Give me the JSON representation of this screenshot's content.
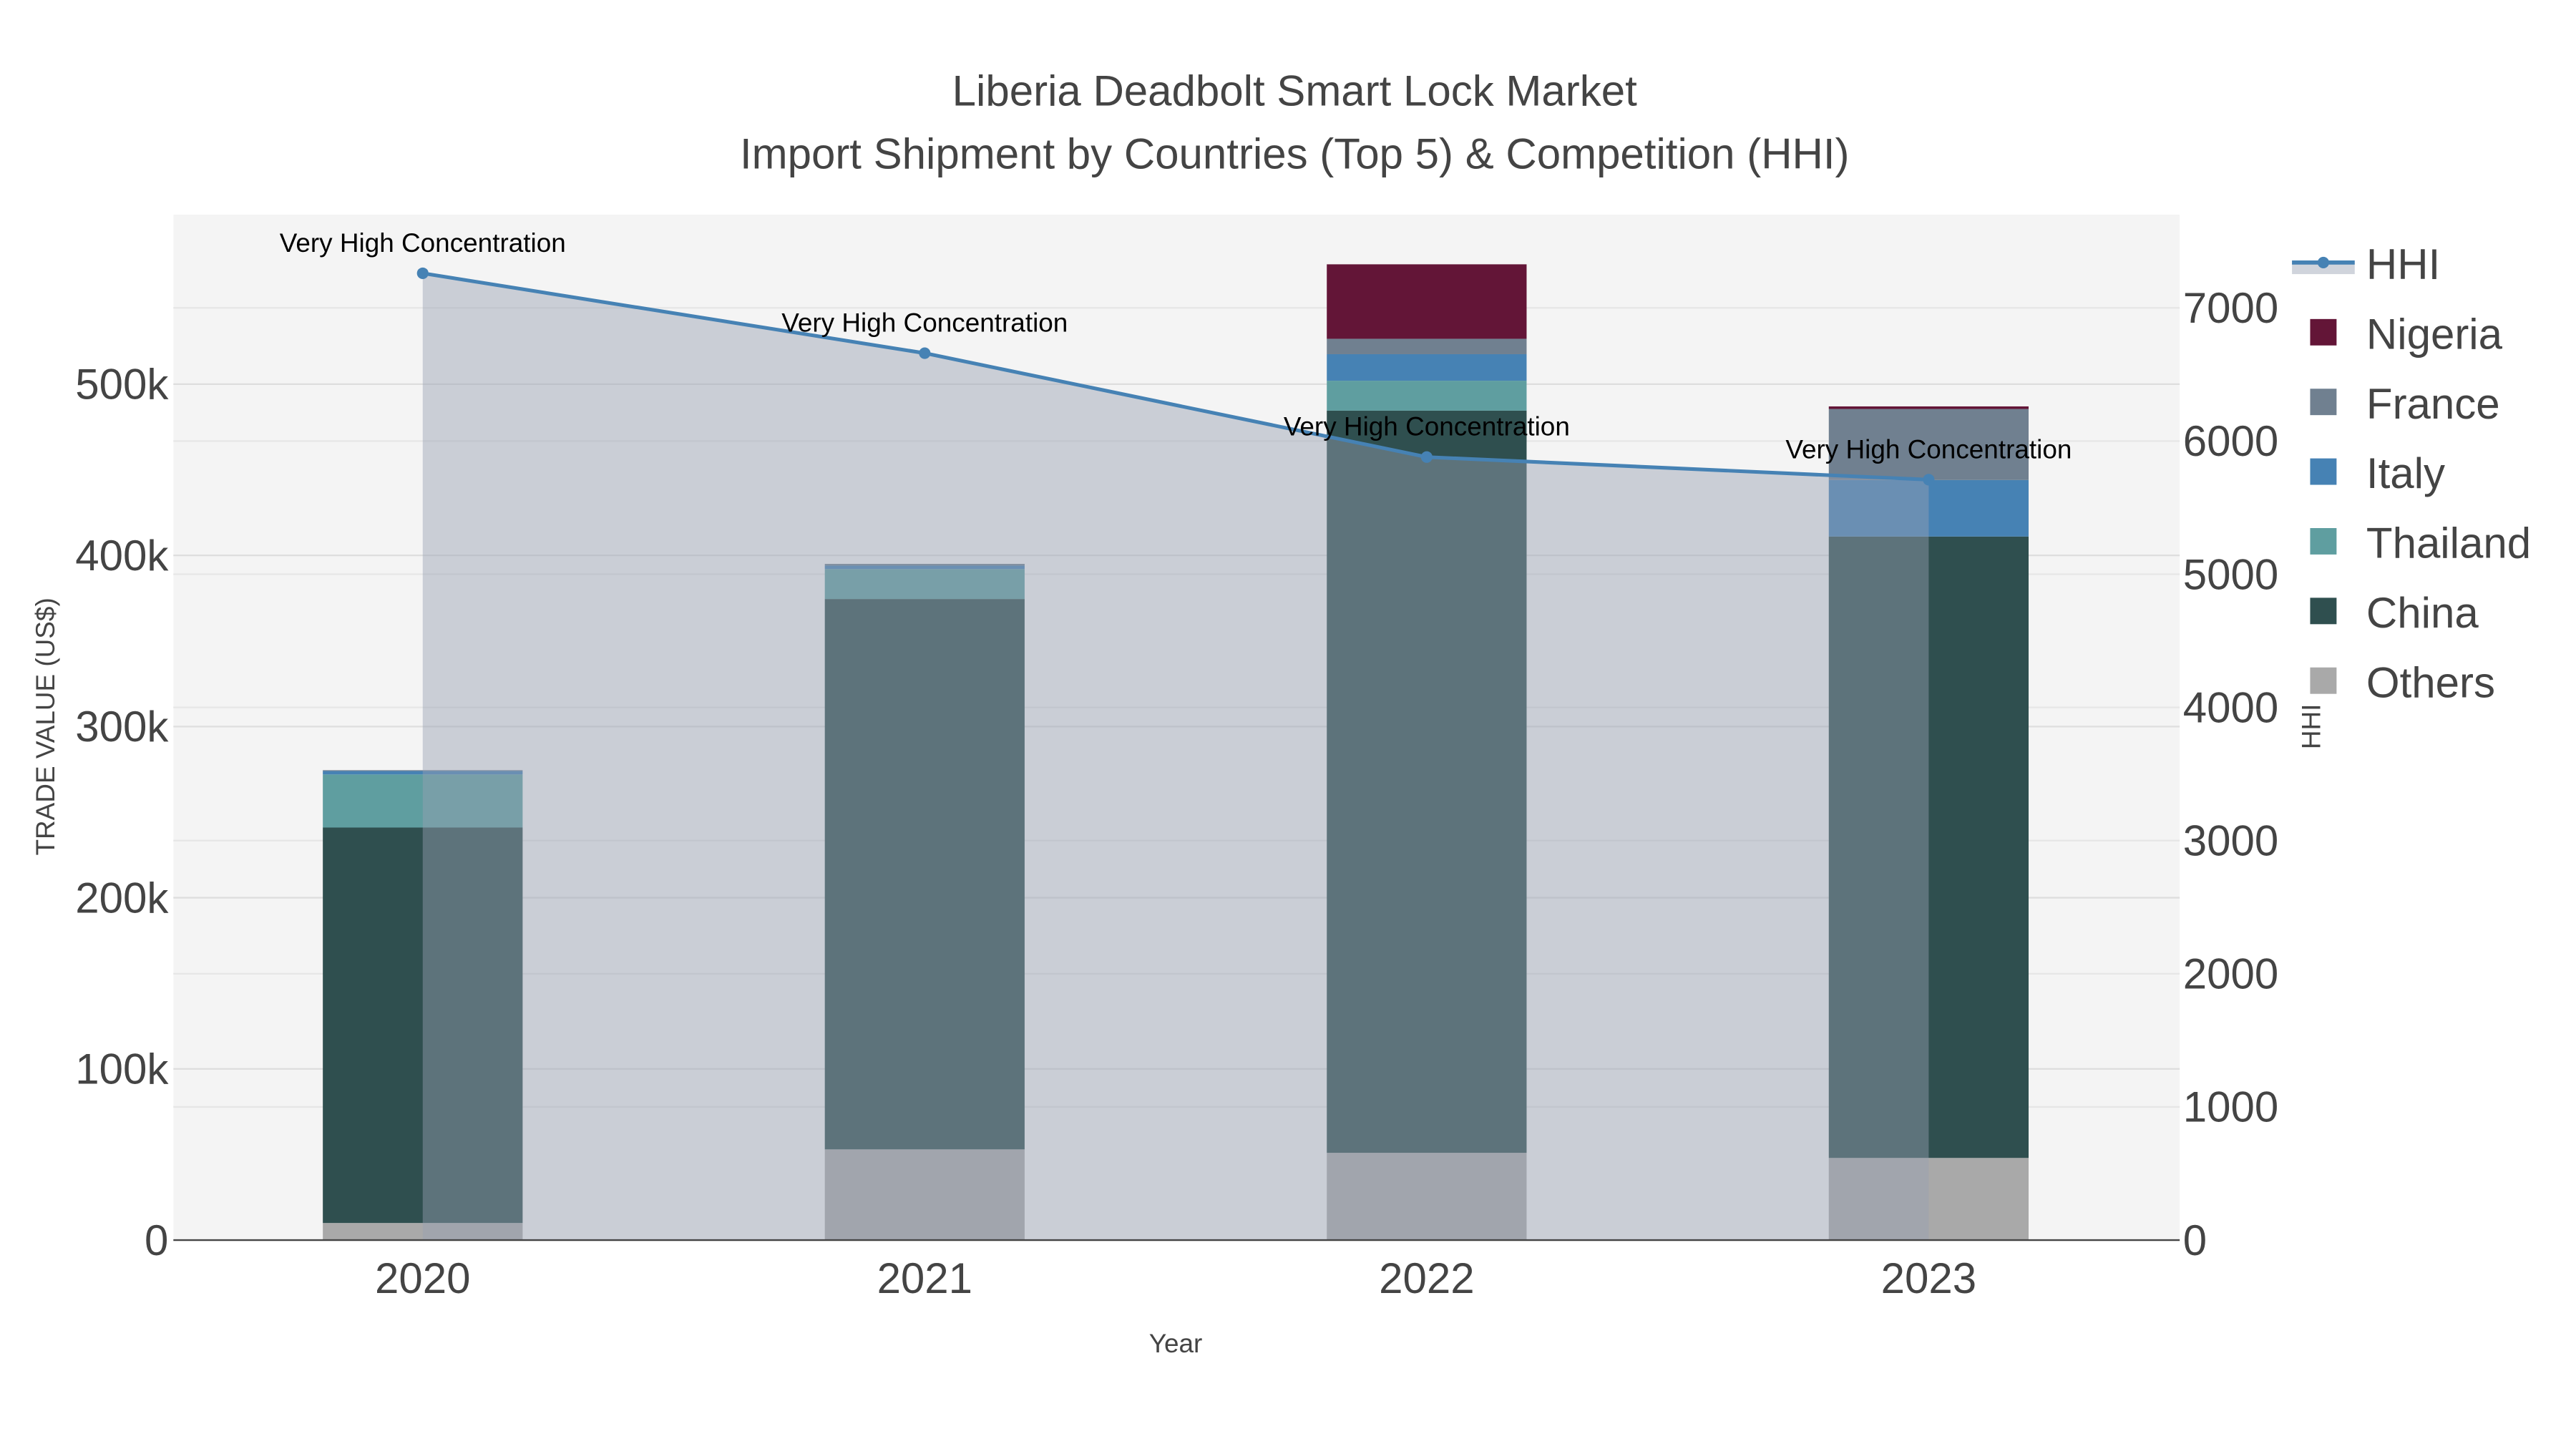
{
  "chart_data": {
    "type": "bar",
    "title_line1": "Liberia Deadbolt Smart Lock Market",
    "title_line2": "Import Shipment by Countries (Top 5) & Competition (HHI)",
    "xlabel": "Year",
    "ylabel": "TRADE VALUE (US$)",
    "y2label": "HHI",
    "categories": [
      "2020",
      "2021",
      "2022",
      "2023"
    ],
    "ylim": [
      0,
      599000
    ],
    "y2lim": [
      0,
      7700
    ],
    "yticks": [
      0,
      100000,
      200000,
      300000,
      400000,
      500000
    ],
    "ytick_labels": [
      "0",
      "100k",
      "200k",
      "300k",
      "400k",
      "500k"
    ],
    "y2ticks": [
      0,
      1000,
      2000,
      3000,
      4000,
      5000,
      6000,
      7000
    ],
    "y2tick_labels": [
      "0",
      "1000",
      "2000",
      "3000",
      "4000",
      "5000",
      "6000",
      "7000"
    ],
    "stacked": true,
    "series": [
      {
        "name": "Others",
        "color": "#a9a9a9",
        "values": [
          10000,
          53000,
          51000,
          48000
        ]
      },
      {
        "name": "China",
        "color": "#2f4f4f",
        "values": [
          231000,
          321500,
          433500,
          363000
        ]
      },
      {
        "name": "Thailand",
        "color": "#5f9ea0",
        "values": [
          31000,
          17500,
          17500,
          0
        ]
      },
      {
        "name": "Italy",
        "color": "#4682b4",
        "values": [
          2000,
          2000,
          15500,
          33000
        ]
      },
      {
        "name": "France",
        "color": "#708090",
        "values": [
          500,
          1000,
          9000,
          41500
        ]
      },
      {
        "name": "Nigeria",
        "color": "#631537",
        "values": [
          0,
          0,
          43500,
          1500
        ]
      }
    ],
    "line": {
      "name": "HHI",
      "color": "#4682b4",
      "values": [
        7260,
        6660,
        5880,
        5710
      ],
      "annotations": [
        "Very High Concentration",
        "Very High Concentration",
        "Very High Concentration",
        "Very High Concentration"
      ]
    },
    "legend_order": [
      "HHI",
      "Nigeria",
      "France",
      "Italy",
      "Thailand",
      "China",
      "Others"
    ],
    "legend_position": "right",
    "grid": true
  }
}
